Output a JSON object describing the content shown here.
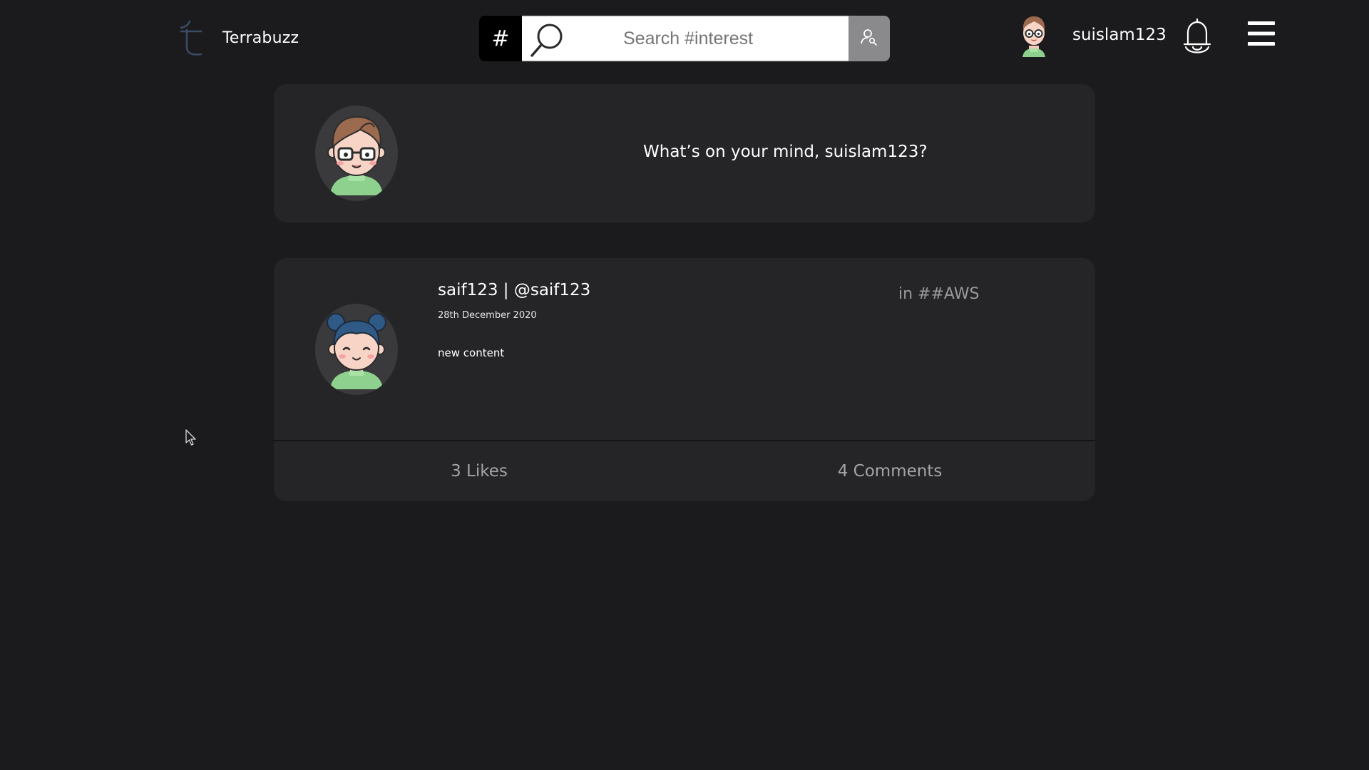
{
  "header": {
    "brand": "Terrabuzz",
    "search": {
      "hash_label": "#",
      "placeholder": "Search #interest"
    },
    "username": "suislam123"
  },
  "composer": {
    "prompt": "What’s on your mind, suislam123?"
  },
  "post": {
    "author": "saif123 | @saif123",
    "date": "28th December 2020",
    "body": "new content",
    "topic": "in ##AWS",
    "likes": "3 Likes",
    "comments": "4 Comments"
  },
  "colors": {
    "background": "#1b1b1d",
    "card": "#252527",
    "muted_text": "#a4a4a6",
    "search_hash_button": "#000000",
    "user_search_button": "#8a8a8c"
  },
  "icons": [
    "logo-icon",
    "search-icon",
    "user-search-icon",
    "bell-icon",
    "hamburger-menu-icon",
    "cursor-icon"
  ]
}
